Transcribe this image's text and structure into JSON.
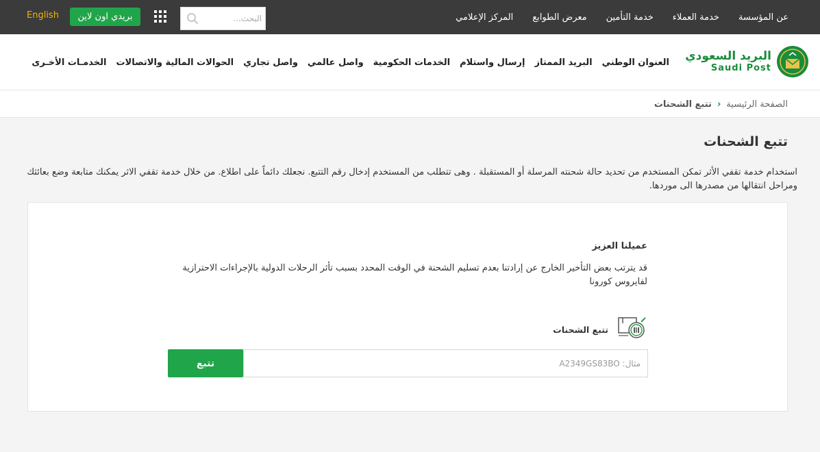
{
  "topbar": {
    "links": [
      "عن المؤسسة",
      "خدمة العملاء",
      "خدمة التأمين",
      "معرض الطوابع",
      "المركز الإعلامي"
    ],
    "search_placeholder": "البحث...",
    "online_button": "بريدي اون لاين",
    "language_link": "English",
    "icons": {
      "search": "search-icon",
      "apps": "grid-icon"
    },
    "colors": {
      "background": "#3b3b3b",
      "language": "#f5b400",
      "button": "#20a54a"
    }
  },
  "logo": {
    "arabic": "البريد السعودي",
    "english": "Saudi Post"
  },
  "main_nav": [
    "العنوان الوطني",
    "البريد الممتاز",
    "إرسال واستلام",
    "الخدمات الحكومية",
    "واصل عالمي",
    "واصل تجاري",
    "الحوالات المالية والاتصالات",
    "الخدمـات الأخـرى"
  ],
  "breadcrumb": {
    "home": "الصفحة الرئيسية",
    "separator": "›",
    "current": "تتبع الشحنات"
  },
  "page": {
    "title": "تتبع الشحنات",
    "description": "استخدام خدمة تقفي الأثر تمكن المستخدم من تحديد حالة شحنته المرسلة أو المستقبلة . وهى تتطلب من المستخدم إدخال رقم التتبع. نجعلك دائماً على اطلاع. من خلال خدمة تقفي الاثر يمكنك متابعة وضع بعائثك ومراحل انتقالها من مصدرها الى موردها."
  },
  "card": {
    "notice_title": "عميلنا العزيز",
    "notice_body": "قد يترتب بعض التأخير الخارج عن إرادتنا بعدم تسليم الشحنة في الوقت المحدد بسبب تأثر الرحلات الدولية بالإجراءات الاحترازية لفايروس كورونا",
    "track_label": "تتبع الشحنات",
    "track_placeholder": "مثال: A2349GS83BO",
    "track_button": "تتبع",
    "track_icon": "parcel-tracking-icon"
  },
  "colors": {
    "brand_green": "#1a8c3c",
    "button_green": "#20a54a",
    "page_bg": "#f4f4f4"
  }
}
